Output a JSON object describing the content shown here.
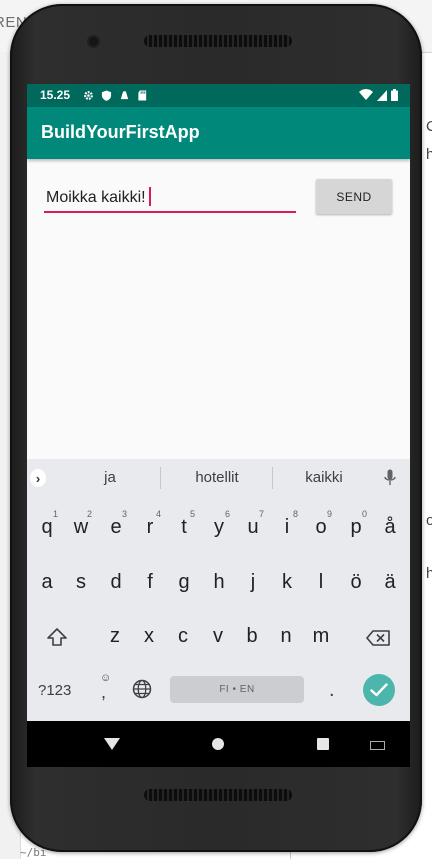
{
  "background": {
    "top_left_fragment": "REN",
    "right_edge_chars": [
      "C",
      "h",
      "o",
      "h"
    ],
    "bottom_fragment": "~/bi"
  },
  "status_bar": {
    "time": "15.25",
    "background_color": "#00695c",
    "left_icons": [
      "gear-icon",
      "shield-icon",
      "app-icon",
      "sd-card-icon"
    ],
    "right_icons": [
      "wifi-icon",
      "signal-icon",
      "battery-icon"
    ]
  },
  "app_bar": {
    "title": "BuildYourFirstApp",
    "background_color": "#00897b"
  },
  "message_input": {
    "value": "Moikka kaikki!",
    "underline_color": "#d81b60"
  },
  "send_button": {
    "label": "SEND"
  },
  "keyboard": {
    "suggestions": [
      "ja",
      "hotellit",
      "kaikki"
    ],
    "row1": [
      {
        "key": "q",
        "hint": "1"
      },
      {
        "key": "w",
        "hint": "2"
      },
      {
        "key": "e",
        "hint": "3"
      },
      {
        "key": "r",
        "hint": "4"
      },
      {
        "key": "t",
        "hint": "5"
      },
      {
        "key": "y",
        "hint": "6"
      },
      {
        "key": "u",
        "hint": "7"
      },
      {
        "key": "i",
        "hint": "8"
      },
      {
        "key": "o",
        "hint": "9"
      },
      {
        "key": "p",
        "hint": "0"
      },
      {
        "key": "å",
        "hint": ""
      }
    ],
    "row2": [
      "a",
      "s",
      "d",
      "f",
      "g",
      "h",
      "j",
      "k",
      "l",
      "ö",
      "ä"
    ],
    "row3": [
      "z",
      "x",
      "c",
      "v",
      "b",
      "n",
      "m"
    ],
    "symbols_label": "?123",
    "comma_key": ",",
    "emoji_hint": "☺",
    "space_label": "FI • EN",
    "period_key": ".",
    "enter_color": "#4db6ac"
  }
}
